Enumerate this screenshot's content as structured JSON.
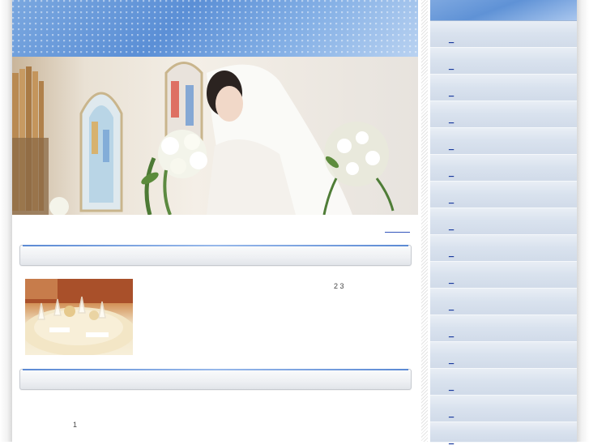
{
  "header": {
    "top_link": ""
  },
  "content": {
    "article_text_1": "2 3",
    "article_text_2": "1"
  },
  "sidebar": {
    "items": [
      {
        "label": "_"
      },
      {
        "label": "_"
      },
      {
        "label": "_"
      },
      {
        "label": "_"
      },
      {
        "label": "_"
      },
      {
        "label": "_"
      },
      {
        "label": "_"
      },
      {
        "label": "_"
      },
      {
        "label": "_"
      },
      {
        "label": "_"
      },
      {
        "label": "_"
      },
      {
        "label": "_"
      },
      {
        "label": "_"
      },
      {
        "label": "_"
      },
      {
        "label": "_"
      },
      {
        "label": "_"
      }
    ]
  },
  "colors": {
    "banner": "#5b8fd6",
    "sidebar_item": "#d9e2ee",
    "link": "#1a3b9e"
  },
  "icons": [
    "bride-hero-photo",
    "banquet-table-photo"
  ]
}
